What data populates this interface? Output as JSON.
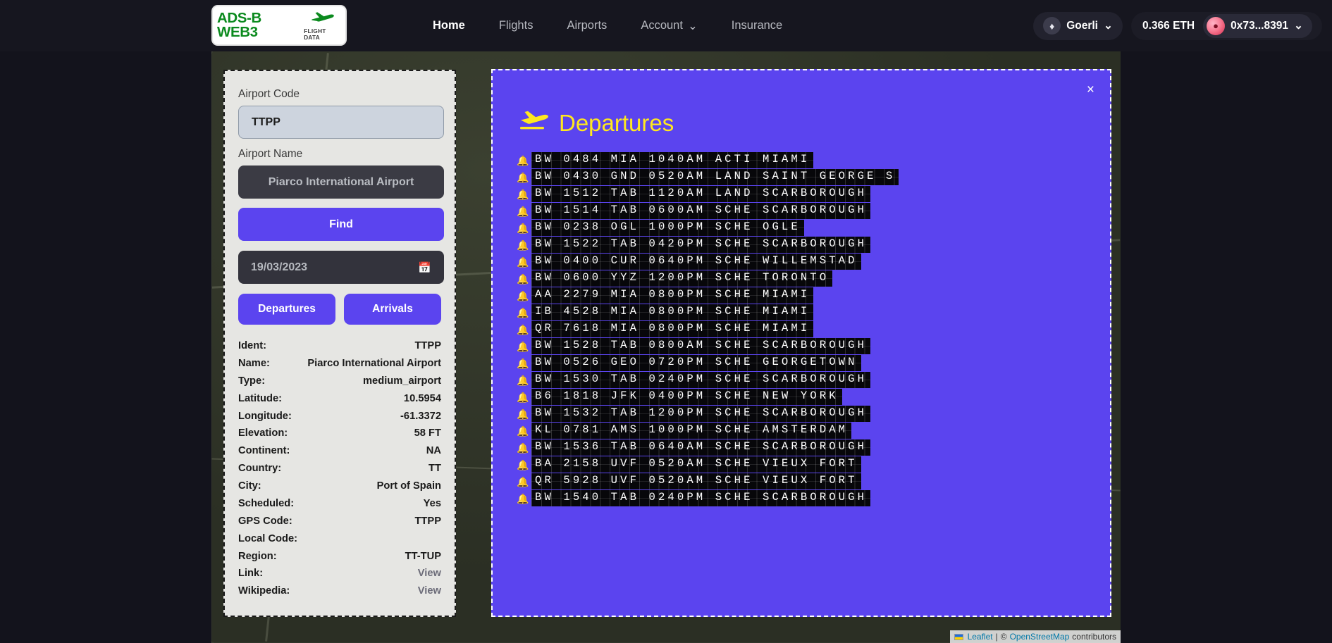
{
  "header": {
    "logo": {
      "text": "ADS-B WEB3",
      "subtitle": "FLIGHT DATA",
      "icon": "airplane-icon"
    },
    "nav": [
      {
        "label": "Home",
        "active": true
      },
      {
        "label": "Flights",
        "active": false
      },
      {
        "label": "Airports",
        "active": false
      },
      {
        "label": "Account",
        "active": false,
        "caret": "⌄"
      },
      {
        "label": "Insurance",
        "active": false
      }
    ],
    "network": {
      "label": "Goerli",
      "icon": "ethereum-icon",
      "caret": "⌄"
    },
    "balance": "0.366 ETH",
    "wallet": {
      "address": "0x73...8391",
      "icon": "avatar-icon",
      "caret": "⌄"
    }
  },
  "sidebar": {
    "airport_code_label": "Airport Code",
    "airport_code_value": "TTPP",
    "airport_name_label": "Airport Name",
    "airport_name_value": "Piarco International Airport",
    "find_label": "Find",
    "date_value": "19/03/2023",
    "date_icon": "calendar-icon",
    "departures_label": "Departures",
    "arrivals_label": "Arrivals",
    "info": [
      {
        "key": "Ident:",
        "value": "TTPP",
        "link": false
      },
      {
        "key": "Name:",
        "value": "Piarco International Airport",
        "link": false
      },
      {
        "key": "Type:",
        "value": "medium_airport",
        "link": false
      },
      {
        "key": "Latitude:",
        "value": "10.5954",
        "link": false
      },
      {
        "key": "Longitude:",
        "value": "-61.3372",
        "link": false
      },
      {
        "key": "Elevation:",
        "value": "58 FT",
        "link": false
      },
      {
        "key": "Continent:",
        "value": "NA",
        "link": false
      },
      {
        "key": "Country:",
        "value": "TT",
        "link": false
      },
      {
        "key": "City:",
        "value": "Port of Spain",
        "link": false
      },
      {
        "key": "Scheduled:",
        "value": "Yes",
        "link": false
      },
      {
        "key": "GPS Code:",
        "value": "TTPP",
        "link": false
      },
      {
        "key": "Local Code:",
        "value": "",
        "link": false
      },
      {
        "key": "Region:",
        "value": "TT-TUP",
        "link": false
      },
      {
        "key": "Link:",
        "value": "View",
        "link": true
      },
      {
        "key": "Wikipedia:",
        "value": "View",
        "link": true
      }
    ]
  },
  "modal": {
    "title": "Departures",
    "title_icon": "airplane-takeoff-icon",
    "close_label": "×",
    "bell_icon": "bell-icon",
    "flights": [
      "BW 0484 MIA 1040AM ACTI MIAMI",
      "BW 0430 GND 0520AM LAND SAINT GEORGE S",
      "BW 1512 TAB 1120AM LAND SCARBOROUGH",
      "BW 1514 TAB 0600AM SCHE SCARBOROUGH",
      "BW 0238 OGL 1000PM SCHE OGLE",
      "BW 1522 TAB 0420PM SCHE SCARBOROUGH",
      "BW 0400 CUR 0640PM SCHE WILLEMSTAD",
      "BW 0600 YYZ 1200PM SCHE TORONTO",
      "AA 2279 MIA 0800PM SCHE MIAMI",
      "IB 4528 MIA 0800PM SCHE MIAMI",
      "QR 7618 MIA 0800PM SCHE MIAMI",
      "BW 1528 TAB 0800AM SCHE SCARBOROUGH",
      "BW 0526 GEO 0720PM SCHE GEORGETOWN",
      "BW 1530 TAB 0240PM SCHE SCARBOROUGH",
      "B6 1818 JFK 0400PM SCHE NEW YORK",
      "BW 1532 TAB 1200PM SCHE SCARBOROUGH",
      "KL 0781 AMS 1000PM SCHE AMSTERDAM",
      "BW 1536 TAB 0640AM SCHE SCARBOROUGH",
      "BA 2158 UVF 0520AM SCHE VIEUX FORT",
      "QR 5928 UVF 0520AM SCHE VIEUX FORT",
      "BW 1540 TAB 0240PM SCHE SCARBOROUGH"
    ]
  },
  "map": {
    "attribution_prefix": "",
    "leaflet_label": "Leaflet",
    "separator": " | ",
    "copyright": "© ",
    "osm_label": "OpenStreetMap",
    "contributors_label": " contributors"
  },
  "colors": {
    "accent": "#5b44ef",
    "header_bg": "#16161f",
    "panel_bg": "#e6e6e3",
    "flap_bg": "#07070a",
    "title_yellow": "#ffe81f",
    "logo_green": "#0b8a1e"
  }
}
